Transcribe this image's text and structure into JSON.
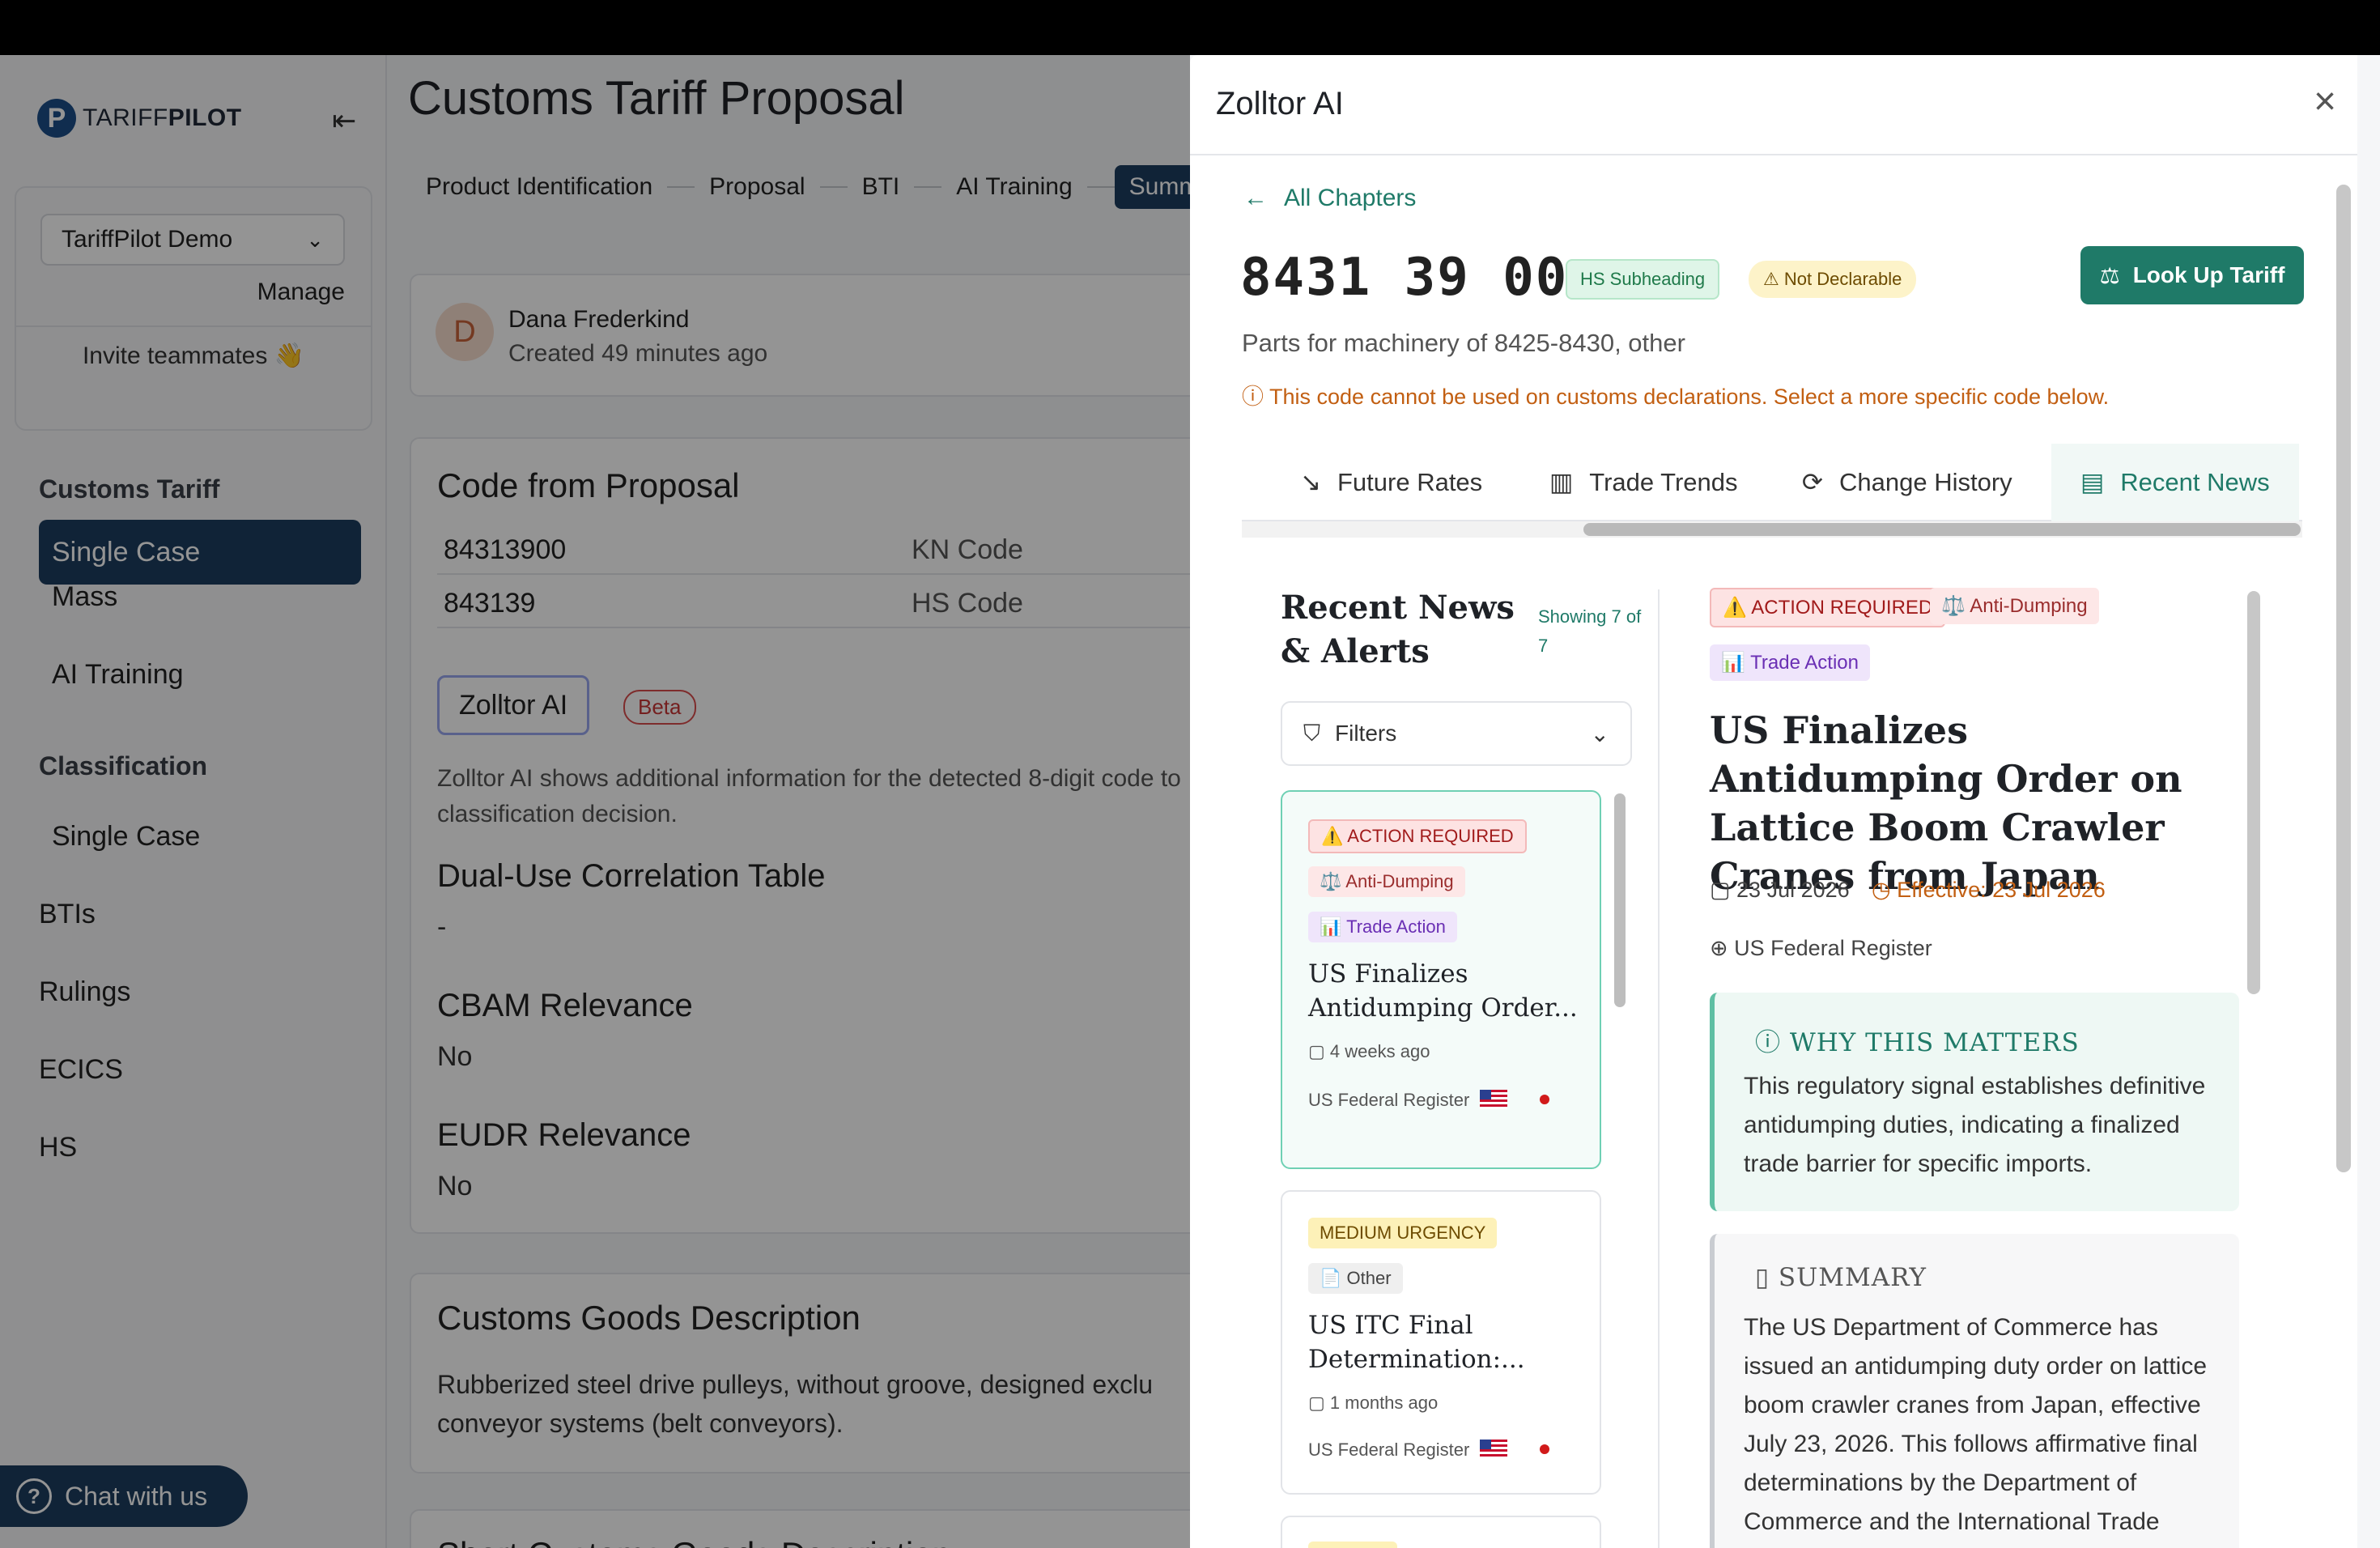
{
  "app": {
    "brand_light": "TARIFF",
    "brand_bold": "PILOT",
    "org_name": "TariffPilot Demo",
    "manage": "Manage",
    "invite": "Invite teammates 👋",
    "nav": {
      "customs_heading": "Customs Tariff",
      "single_case": "Single Case",
      "mass": "Mass",
      "ai_training": "AI Training",
      "classification_heading": "Classification",
      "class_single_case": "Single Case",
      "btis": "BTIs",
      "rulings": "Rulings",
      "ecics": "ECICS",
      "hs": "HS"
    },
    "chat": "Chat with us"
  },
  "main": {
    "title": "Customs Tariff Proposal",
    "steps": [
      "Product Identification",
      "Proposal",
      "BTI",
      "AI Training",
      "Summar"
    ],
    "author": {
      "initial": "D",
      "name": "Dana Frederkind",
      "meta": "Created 49 minutes ago"
    },
    "code_card": {
      "heading": "Code from Proposal",
      "rows": [
        {
          "value": "84313900",
          "key": "KN Code"
        },
        {
          "value": "843139",
          "key": "HS Code"
        }
      ],
      "zolltor_btn": "Zolltor AI",
      "beta": "Beta",
      "desc_line1": "Zolltor AI shows additional information for the detected 8-digit code to",
      "desc_line2": "classification decision.",
      "dual_use_h": "Dual-Use Correlation Table",
      "dual_use_v": "-",
      "cbam_h": "CBAM Relevance",
      "cbam_v": "No",
      "eudr_h": "EUDR Relevance",
      "eudr_v": "No"
    },
    "goods_card": {
      "heading": "Customs Goods Description",
      "line1": "Rubberized steel drive pulleys, without groove, designed exclu",
      "line2": "conveyor systems (belt conveyors)."
    },
    "short_card": {
      "heading": "Short Customs Goods Description"
    }
  },
  "modal": {
    "title": "Zolltor AI",
    "close": "×",
    "back": "All Chapters",
    "code": "8431 39 00",
    "badge_hs": "HS Subheading",
    "badge_nd": "Not Declarable",
    "lookup": "Look Up Tariff",
    "code_desc": "Parts for machinery of 8425-8430, other",
    "warning": "This code cannot be used on customs declarations. Select a more specific code below.",
    "tabs": [
      "Future Rates",
      "Trade Trends",
      "Change History",
      "Recent News"
    ],
    "news": {
      "heading": "Recent News & Alerts",
      "showing": "Showing 7 of 7",
      "filters": "Filters",
      "items": [
        {
          "tags": [
            "⚠️ ACTION REQUIRED",
            "⚖️ Anti-Dumping",
            "📊 Trade Action"
          ],
          "title_line1": "US Finalizes",
          "title_line2": "Antidumping Order...",
          "age": "4 weeks ago",
          "source": "US Federal Register"
        },
        {
          "tags": [
            "MEDIUM URGENCY",
            "📄 Other"
          ],
          "title_line1": "US ITC Final",
          "title_line2": "Determination:...",
          "age": "1 months ago",
          "source": "US Federal Register"
        }
      ],
      "detail": {
        "tags": [
          "⚠️ ACTION REQUIRED",
          "⚖️ Anti-Dumping",
          "📊 Trade Action"
        ],
        "title": "US Finalizes Antidumping Order on Lattice Boom Crawler Cranes from Japan",
        "date": "23 Jul 2026",
        "effective": "Effective: 23 Jul 2026",
        "source": "US Federal Register",
        "why_h": "WHY THIS MATTERS",
        "why_t": "This regulatory signal establishes definitive antidumping duties, indicating a finalized trade barrier for specific imports.",
        "summary_h": "SUMMARY",
        "summary_t": "The US Department of Commerce has issued an antidumping duty order on lattice boom crawler cranes from Japan, effective July 23, 2026. This follows affirmative final determinations by the Department of Commerce and the International Trade"
      }
    }
  }
}
